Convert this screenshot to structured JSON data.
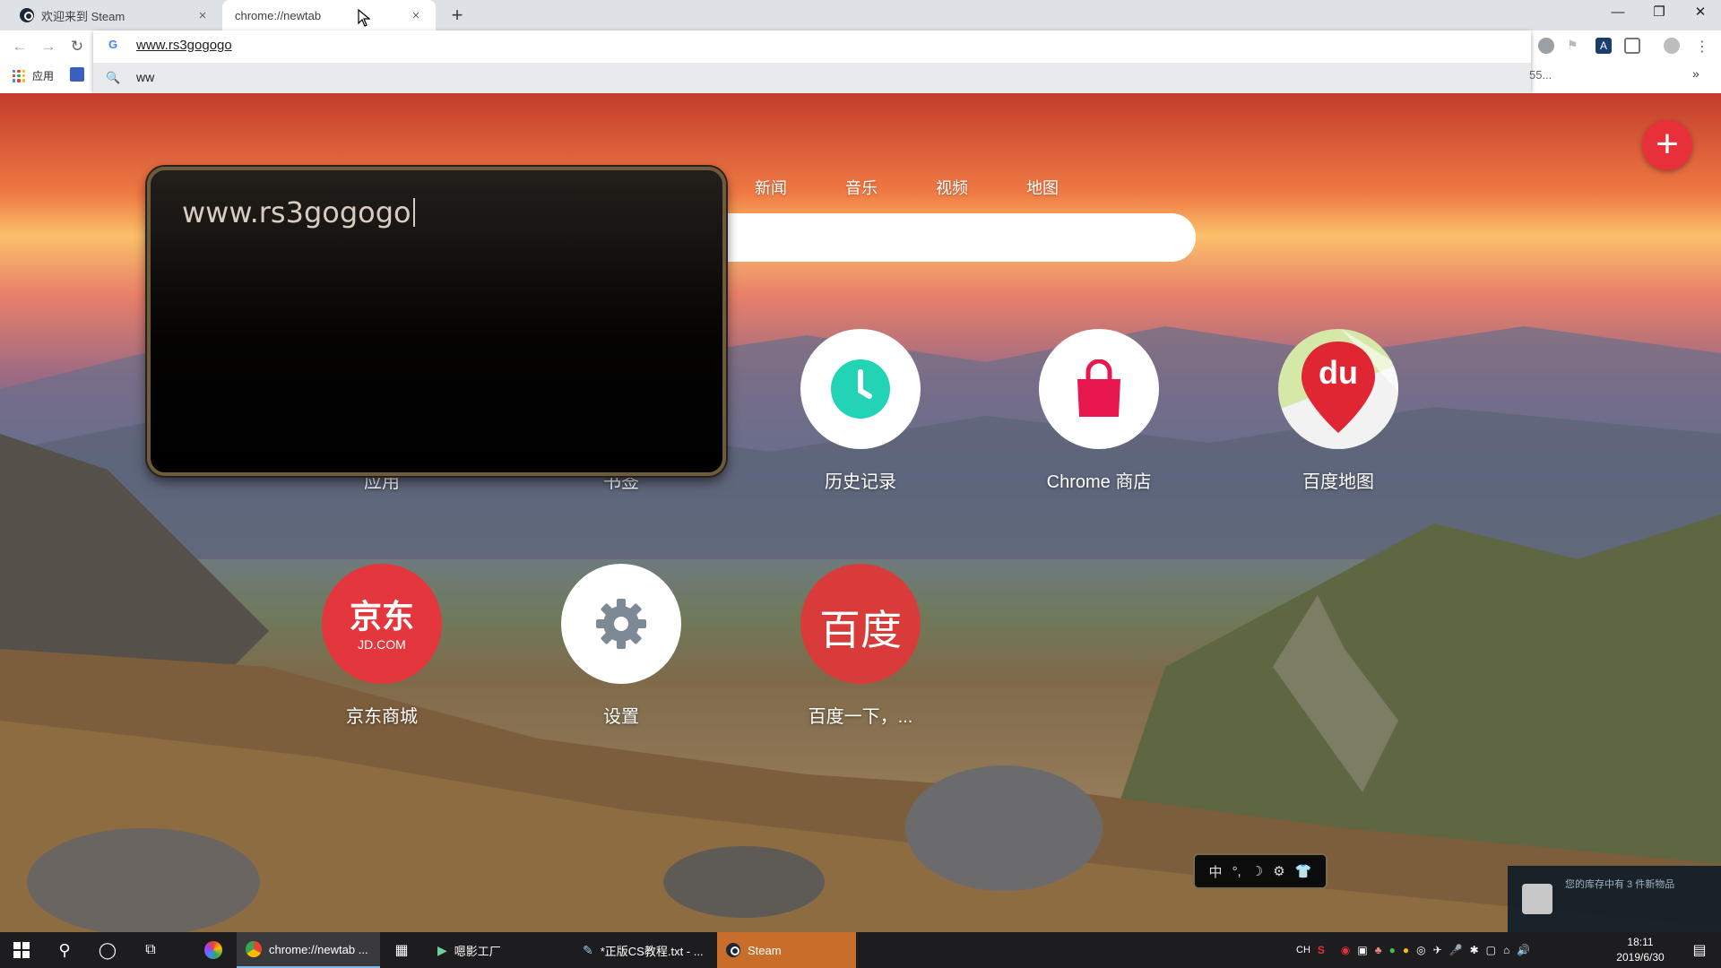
{
  "tabs": [
    {
      "label": "欢迎来到 Steam",
      "close": "×"
    },
    {
      "label": "chrome://newtab",
      "close": "×"
    }
  ],
  "new_tab": "+",
  "window_controls": [
    "—",
    "❐",
    "✕"
  ],
  "omnibox": {
    "value": "www.rs3gogogo",
    "suggestion_text": "ww",
    "suggestion_right": "55..."
  },
  "bookmarks": {
    "apps_label": "应用",
    "more": "»"
  },
  "page": {
    "nav_links": [
      "新闻",
      "音乐",
      "视频",
      "地图"
    ],
    "popup_text": "www.rs3gogogo",
    "tiles_row1": [
      {
        "label": "应用",
        "icon": "apps-icon"
      },
      {
        "label": "书签",
        "icon": "star-icon"
      },
      {
        "label": "历史记录",
        "icon": "clock-icon"
      },
      {
        "label": "Chrome 商店",
        "icon": "shopping-bag-icon"
      },
      {
        "label": "百度地图",
        "icon": "baidu-map-icon"
      }
    ],
    "tiles_row2": [
      {
        "label": "京东商城",
        "logo_main": "京东",
        "logo_sub": "JD.COM"
      },
      {
        "label": "设置",
        "icon": "gear-icon"
      },
      {
        "label": "百度一下，...",
        "logo_main": "百度"
      }
    ],
    "baidu_map_logo": "du",
    "ime_bar": [
      "中",
      "°,",
      "☽",
      "⚙",
      "👕"
    ],
    "notification": "您的库存中有 3 件新物品"
  },
  "taskbar": {
    "apps": [
      {
        "label": "chrome://newtab ..."
      },
      {
        "label": "嗯影工厂"
      },
      {
        "label": "*正版CS教程.txt - ..."
      },
      {
        "label": "Steam"
      }
    ],
    "tray_lang": "CH",
    "time": "18:11",
    "date": "2019/6/30"
  },
  "colors": {
    "fab_red": "#e8303a",
    "jd_red": "#e3373d",
    "baidu_red": "#d93b3b",
    "history_teal": "#22d3b5",
    "store_pink": "#e8174d",
    "apps_purple": "#7b3fe4",
    "bookmark_yellow": "#f9c524"
  }
}
